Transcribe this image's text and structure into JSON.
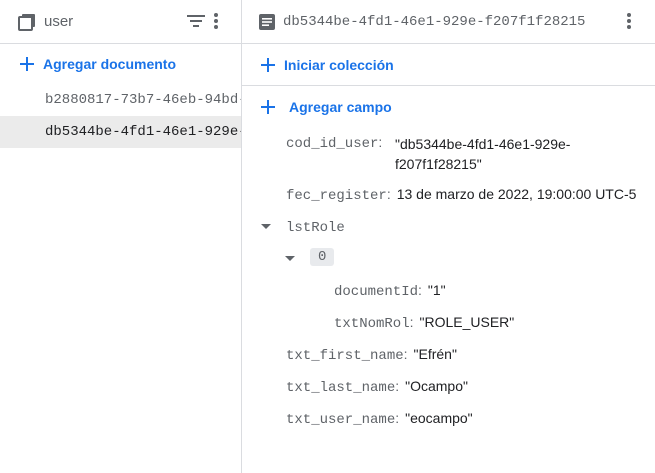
{
  "collection": {
    "name": "user",
    "add_document_label": "Agregar documento",
    "documents": [
      {
        "id": "b2880817-73b7-46eb-94bd-"
      },
      {
        "id": "db5344be-4fd1-46e1-929e-"
      }
    ]
  },
  "document": {
    "title": "db5344be-4fd1-46e1-929e-f207f1f28215",
    "start_collection_label": "Iniciar colección",
    "add_field_label": "Agregar campo",
    "fields": {
      "cod_id_user": {
        "key": "cod_id_user",
        "value_line1": "\"db5344be-4fd1-46e1-929e-",
        "value_line2": "f207f1f28215\""
      },
      "fec_register": {
        "key": "fec_register",
        "value": "13 de marzo de 2022, 19:00:00 UTC-5"
      },
      "lstRole": {
        "key": "lstRole",
        "index": "0",
        "documentId": {
          "key": "documentId",
          "value": "\"1\""
        },
        "txtNomRol": {
          "key": "txtNomRol",
          "value": "\"ROLE_USER\""
        }
      },
      "txt_first_name": {
        "key": "txt_first_name",
        "value": "\"Efrén\""
      },
      "txt_last_name": {
        "key": "txt_last_name",
        "value": "\"Ocampo\""
      },
      "txt_user_name": {
        "key": "txt_user_name",
        "value": "\"eocampo\""
      }
    },
    "separator": ":"
  },
  "colors": {
    "accent": "#1a73e8",
    "muted": "#5f6368",
    "border": "#dadce0",
    "selected_bg": "#ebebeb"
  }
}
